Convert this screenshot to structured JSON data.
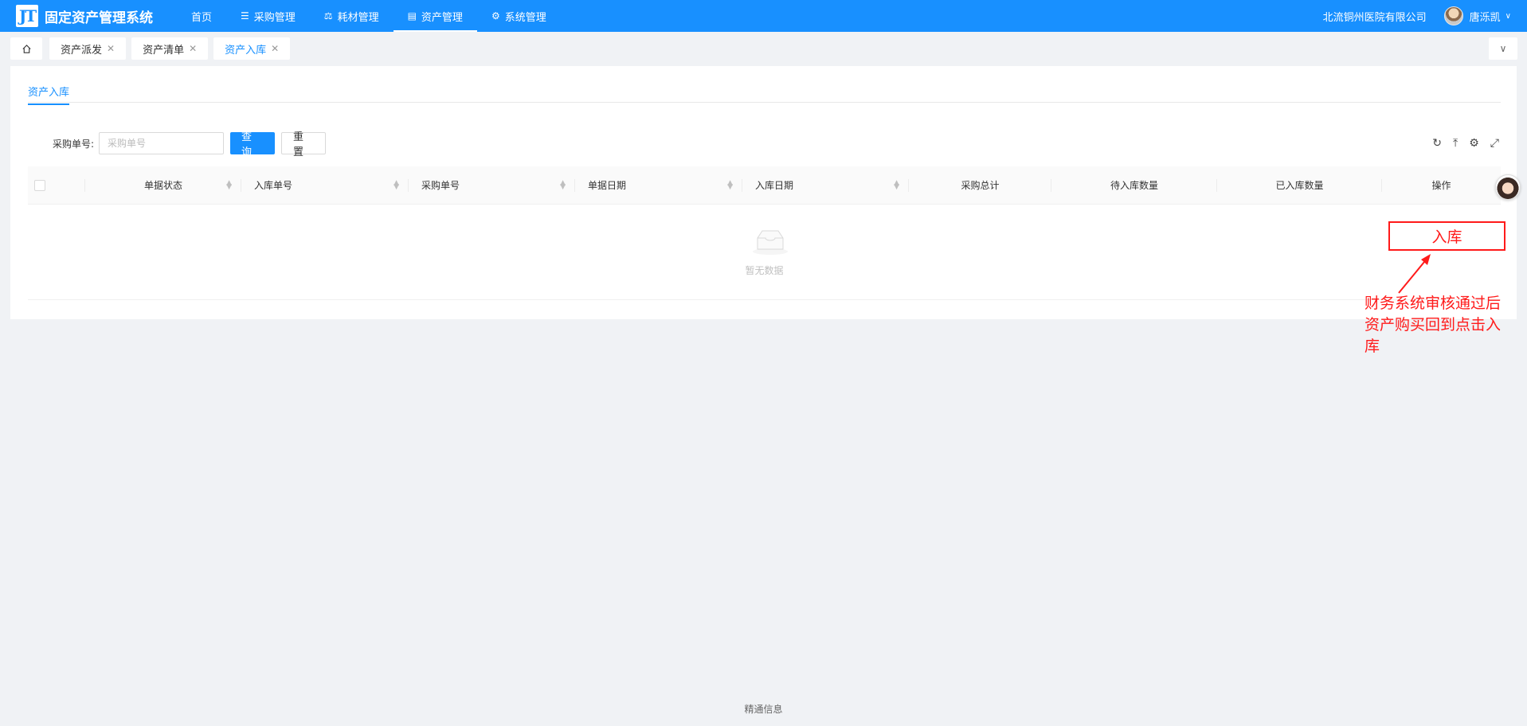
{
  "app": {
    "logo_mark": "JT",
    "title": "固定资产管理系统"
  },
  "nav": [
    {
      "label": "首页",
      "icon": ""
    },
    {
      "label": "采购管理",
      "icon": "cart-icon"
    },
    {
      "label": "耗材管理",
      "icon": "box-icon"
    },
    {
      "label": "资产管理",
      "icon": "calendar-icon",
      "active": true
    },
    {
      "label": "系统管理",
      "icon": "gear-icon"
    }
  ],
  "user": {
    "org": "北流铜州医院有限公司",
    "name": "唐泺凯"
  },
  "tabs": [
    {
      "label": "资产派发"
    },
    {
      "label": "资产清单"
    },
    {
      "label": "资产入库",
      "active": true
    }
  ],
  "page": {
    "subtab": "资产入库"
  },
  "search": {
    "label": "采购单号:",
    "placeholder": "采购单号",
    "query_label": "查 询",
    "reset_label": "重 置"
  },
  "table": {
    "columns": [
      "单据状态",
      "入库单号",
      "采购单号",
      "单据日期",
      "入库日期",
      "采购总计",
      "待入库数量",
      "已入库数量",
      "操作"
    ],
    "rows": [],
    "empty_text": "暂无数据"
  },
  "annotation": {
    "box_label": "入库",
    "note_lines": [
      "财务系统审核通过后",
      "资产购买回到点击入",
      "库"
    ],
    "color": "#ff1a1a"
  },
  "footer": "精通信息",
  "colors": {
    "primary": "#1890ff",
    "background": "#f0f2f5"
  }
}
